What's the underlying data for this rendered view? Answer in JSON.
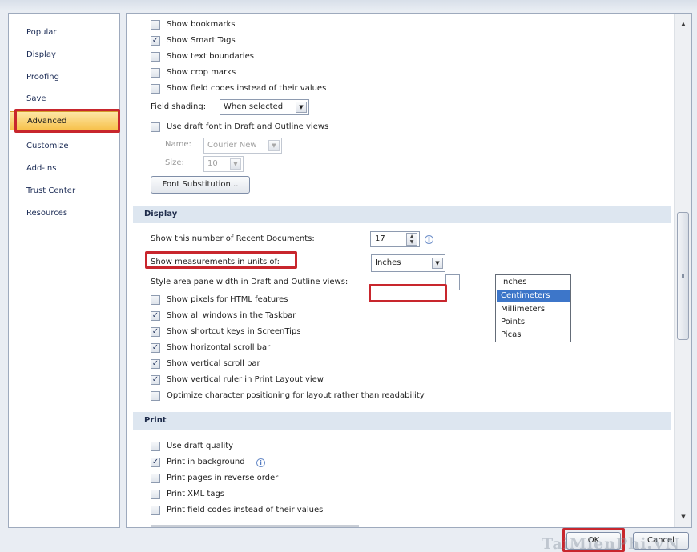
{
  "nav": {
    "items": [
      "Popular",
      "Display",
      "Proofing",
      "Save",
      "Advanced",
      "Customize",
      "Add-Ins",
      "Trust Center",
      "Resources"
    ],
    "selected": "Advanced"
  },
  "top_options": [
    {
      "label": "Show bookmarks",
      "checked": false
    },
    {
      "label": "Show Smart Tags",
      "checked": true
    },
    {
      "label": "Show text boundaries",
      "checked": false
    },
    {
      "label": "Show crop marks",
      "checked": false
    },
    {
      "label": "Show field codes instead of their values",
      "checked": false
    }
  ],
  "field_shading": {
    "label": "Field shading:",
    "value": "When selected"
  },
  "draft_font": {
    "label": "Use draft font in Draft and Outline views",
    "checked": false
  },
  "name_field": {
    "label": "Name:",
    "value": "Courier New"
  },
  "size_field": {
    "label": "Size:",
    "value": "10"
  },
  "font_substitution_button": "Font Substitution...",
  "display": {
    "header": "Display",
    "recent_docs": {
      "label": "Show this number of Recent Documents:",
      "value": "17"
    },
    "measurements": {
      "label": "Show measurements in units of:",
      "value": "Inches"
    },
    "style_area": {
      "label": "Style area pane width in Draft and Outline views:"
    },
    "units_options": [
      "Inches",
      "Centimeters",
      "Millimeters",
      "Points",
      "Picas"
    ],
    "units_highlighted": "Centimeters",
    "options": [
      {
        "label": "Show pixels for HTML features",
        "checked": false
      },
      {
        "label": "Show all windows in the Taskbar",
        "checked": true
      },
      {
        "label": "Show shortcut keys in ScreenTips",
        "checked": true
      },
      {
        "label": "Show horizontal scroll bar",
        "checked": true
      },
      {
        "label": "Show vertical scroll bar",
        "checked": true
      },
      {
        "label": "Show vertical ruler in Print Layout view",
        "checked": true
      },
      {
        "label": "Optimize character positioning for layout rather than readability",
        "checked": false
      }
    ]
  },
  "print": {
    "header": "Print",
    "options": [
      {
        "label": "Use draft quality",
        "checked": false
      },
      {
        "label": "Print in background",
        "checked": true
      },
      {
        "label": "Print pages in reverse order",
        "checked": false
      },
      {
        "label": "Print XML tags",
        "checked": false
      },
      {
        "label": "Print field codes instead of their values",
        "checked": false
      }
    ]
  },
  "footer": {
    "ok_label": "OK",
    "cancel_label": "Cancel"
  },
  "colors": {
    "highlight": "#c8262d",
    "selected_nav": "#f7c24d",
    "list_selection": "#3d76c9"
  }
}
